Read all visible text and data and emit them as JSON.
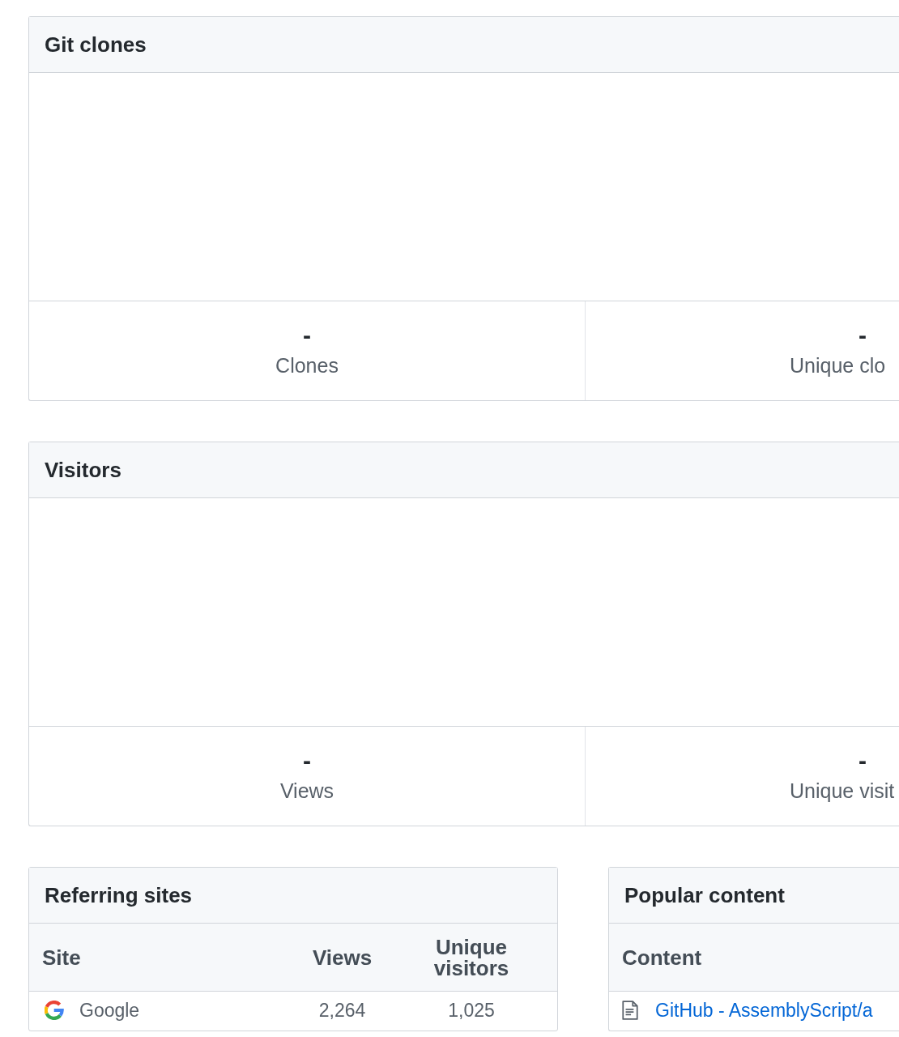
{
  "panels": [
    {
      "title": "Git clones",
      "stats": [
        {
          "value": "-",
          "label": "Clones"
        },
        {
          "value": "-",
          "label": "Unique clo"
        }
      ]
    },
    {
      "title": "Visitors",
      "stats": [
        {
          "value": "-",
          "label": "Views"
        },
        {
          "value": "-",
          "label": "Unique visit"
        }
      ]
    }
  ],
  "referring_sites": {
    "title": "Referring sites",
    "columns": [
      "Site",
      "Views",
      "Unique visitors"
    ],
    "rows": [
      {
        "site": "Google",
        "views": "2,264",
        "unique_visitors": "1,025"
      }
    ]
  },
  "popular_content": {
    "title": "Popular content",
    "columns": [
      "Content"
    ],
    "rows": [
      {
        "content": "GitHub - AssemblyScript/a"
      }
    ]
  }
}
